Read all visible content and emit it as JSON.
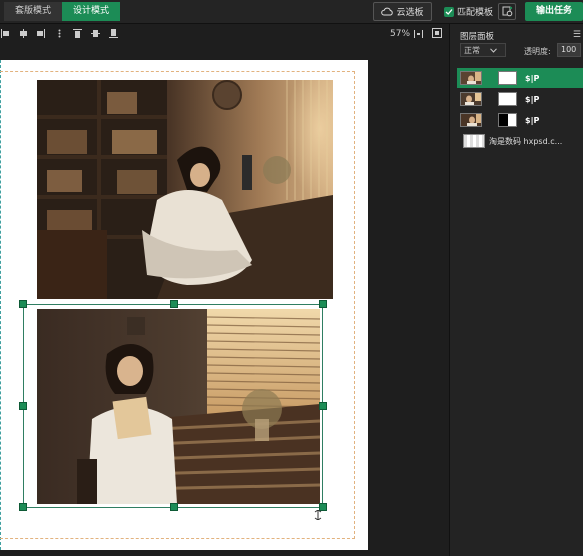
{
  "topbar": {
    "tabs": [
      {
        "label": "套版模式",
        "active": false
      },
      {
        "label": "设计模式",
        "active": true
      }
    ],
    "cloud_button": "云选板",
    "match_checkbox_label": "匹配模板",
    "match_checked": true,
    "export_button": "输出任务"
  },
  "toolbar": {
    "align_icons": [
      "align-left-icon",
      "align-center-h-icon",
      "align-right-icon",
      "more-dots-icon",
      "align-top-icon",
      "align-middle-v-icon",
      "align-bottom-icon"
    ],
    "zoom": "57%"
  },
  "canvas": {
    "photos": [
      {
        "name": "girl-reading-bookshelf-photo"
      },
      {
        "name": "girl-reading-window-photo"
      }
    ]
  },
  "layers_panel": {
    "title": "图层面板",
    "menu_icon": "☰",
    "blend_mode": "正常",
    "opacity_label": "透明度:",
    "opacity_value": "100",
    "layers": [
      {
        "name": "$|P",
        "selected": true,
        "mask": "white"
      },
      {
        "name": "$|P",
        "selected": false,
        "mask": "white"
      },
      {
        "name": "$|P",
        "selected": false,
        "mask": "half"
      },
      {
        "name": "淘是数码 hxpsd.c...",
        "selected": false,
        "type": "text"
      }
    ]
  },
  "colors": {
    "accent": "#1c8c56",
    "background": "#1e1e1e",
    "panel": "#232323",
    "bleed": "#e2b27e"
  }
}
